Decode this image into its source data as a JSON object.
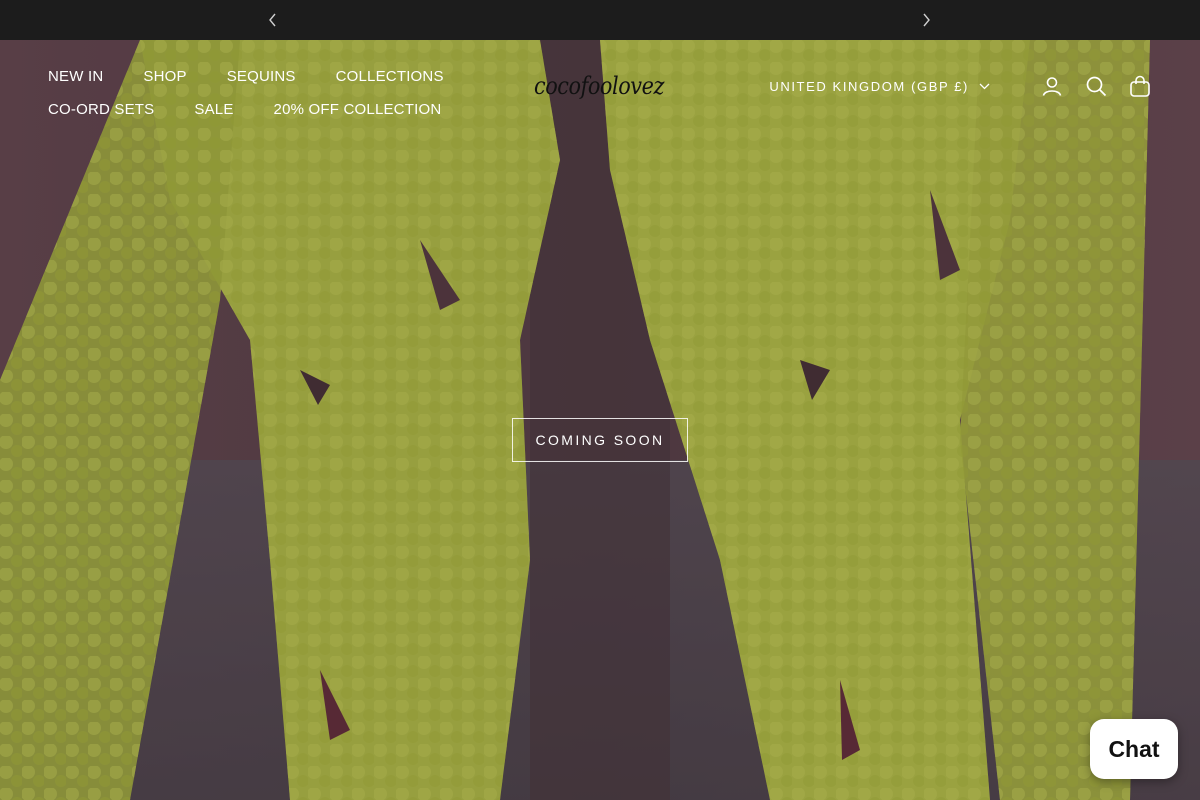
{
  "announcement": {
    "prev_icon": "chevron-left-icon",
    "next_icon": "chevron-right-icon"
  },
  "nav": {
    "row1": [
      "NEW IN",
      "SHOP",
      "SEQUINS",
      "COLLECTIONS"
    ],
    "row2": [
      "CO-ORD SETS",
      "SALE",
      "20% OFF COLLECTION"
    ]
  },
  "logo": {
    "text": "cocofoolovez"
  },
  "header": {
    "country": "UNITED KINGDOM (GBP £)",
    "icons": [
      "account-icon",
      "search-icon",
      "bag-icon"
    ]
  },
  "hero": {
    "cta_label": "COMING SOON"
  },
  "chat": {
    "label": "Chat"
  },
  "colors": {
    "announce_bg": "#1c1c1c",
    "hero_tint": "#5a454c",
    "sequin": "#c9d84a",
    "text": "#ffffff"
  }
}
